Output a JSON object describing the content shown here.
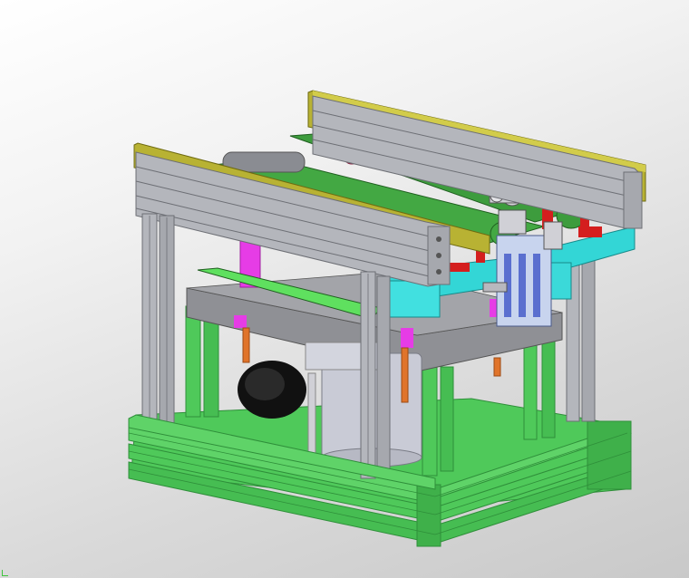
{
  "viewport": {
    "background_top": "#ffffff",
    "background_bottom": "#c9c9c9"
  },
  "colors": {
    "aluminum_profile": "#b4b6bc",
    "aluminum_dark": "#6d6f75",
    "frame_base_green": "#4fc95a",
    "frame_base_green_dark": "#2f8f3a",
    "conveyor_belt": "#3d9c3d",
    "guide_rail_yellow": "#b8b233",
    "gray_plate": "#8f9095",
    "cyan_plate": "#33d6d6",
    "red_bracket": "#d41e1e",
    "magenta_cylinder": "#e63ce6",
    "orange_rod": "#e0742a",
    "motor_black": "#111111",
    "motor_silver": "#c9cbd6",
    "roller_gray": "#8a8c92"
  },
  "icons": [
    "triad-corner-icon"
  ]
}
